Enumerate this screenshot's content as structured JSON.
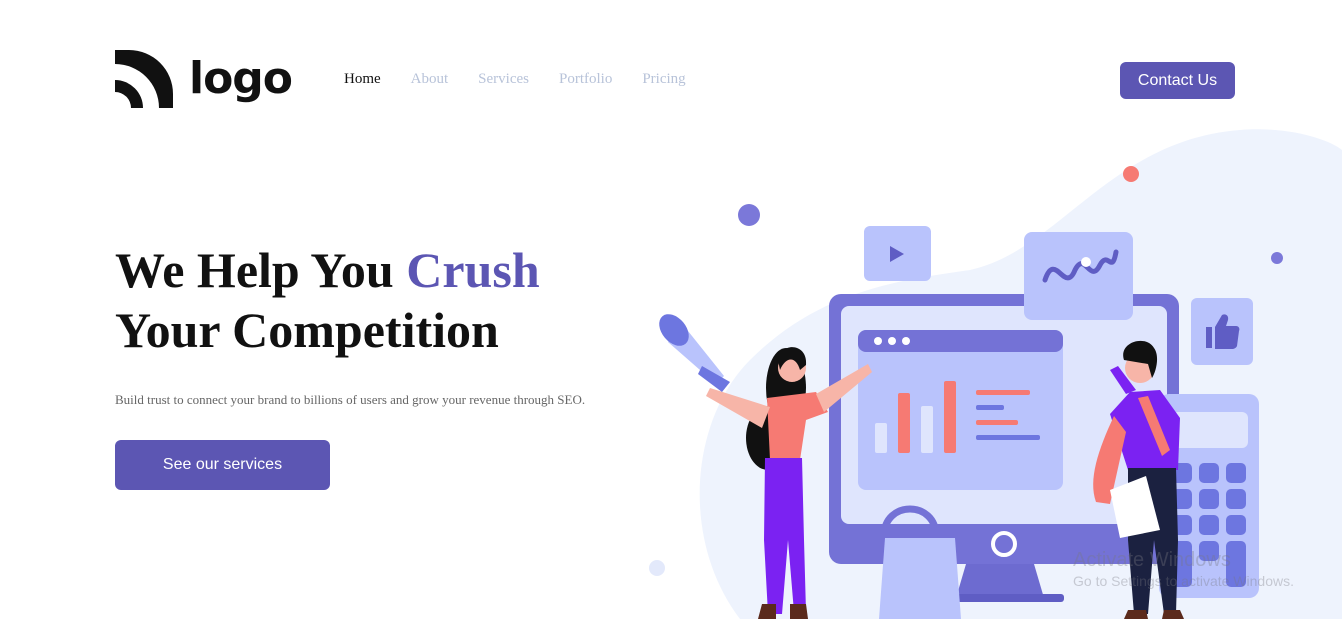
{
  "brand": {
    "logo_text": "logo"
  },
  "nav": {
    "items": [
      {
        "label": "Home",
        "active": true
      },
      {
        "label": "About",
        "active": false
      },
      {
        "label": "Services",
        "active": false
      },
      {
        "label": "Portfolio",
        "active": false
      },
      {
        "label": "Pricing",
        "active": false
      }
    ]
  },
  "header": {
    "contact_label": "Contact Us"
  },
  "hero": {
    "title_part1": "We Help You ",
    "title_accent": "Crush",
    "title_part2": "Your Competition",
    "subtitle": "Build trust to connect your brand to billions of users and grow your revenue through SEO.",
    "cta_label": "See our services"
  },
  "watermark": {
    "title": "Activate Windows",
    "subtitle": "Go to Settings to activate Windows."
  },
  "colors": {
    "accent": "#5c56b3",
    "nav_inactive": "#b8c3d9",
    "blob": "#eef3fd",
    "coral": "#f67a73"
  },
  "icons": [
    "logo-mark-icon",
    "play-icon",
    "thumbs-up-icon",
    "megaphone-icon"
  ]
}
